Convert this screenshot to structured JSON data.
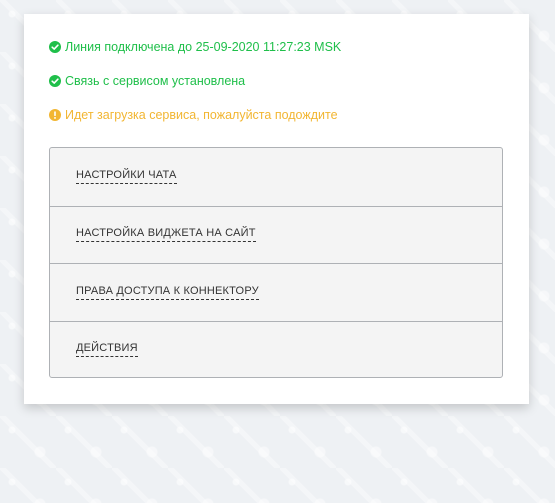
{
  "colors": {
    "success": "#1fbf4a",
    "warning": "#f2b632",
    "panel_bg": "#ffffff",
    "accordion_bg": "#f4f4f4",
    "accordion_border": "#aeb1b5",
    "page_bg": "#eef1f4"
  },
  "statuses": [
    {
      "text": "Линия подключена до 25-09-2020 11:27:23 MSK",
      "state": "success",
      "icon": "check-circle-icon"
    },
    {
      "text": "Связь с сервисом установлена",
      "state": "success",
      "icon": "check-circle-icon"
    },
    {
      "text": "Идет загрузка сервиса, пожалуйста подождите",
      "state": "warning",
      "icon": "exclamation-circle-icon"
    }
  ],
  "accordion": {
    "items": [
      {
        "label": "НАСТРОЙКИ ЧАТА"
      },
      {
        "label": "НАСТРОЙКА ВИДЖЕТА НА САЙТ"
      },
      {
        "label": "ПРАВА ДОСТУПА К КОННЕКТОРУ"
      },
      {
        "label": "ДЕЙСТВИЯ"
      }
    ]
  }
}
